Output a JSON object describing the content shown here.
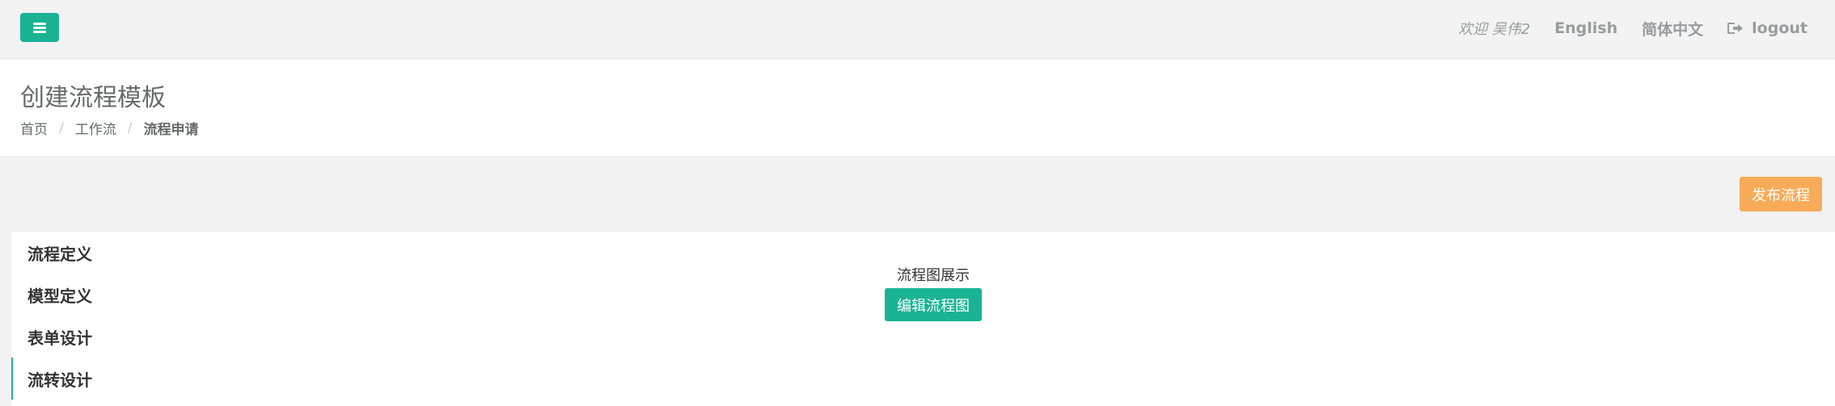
{
  "colors": {
    "accent": "#1ab394",
    "warning": "#f8ac59",
    "topbar_bg": "#f3f3f4"
  },
  "topbar": {
    "menu_icon": "hamburger-icon",
    "welcome": "欢迎 吴伟2",
    "lang_english": "English",
    "lang_chinese": "简体中文",
    "logout_icon": "sign-out-icon",
    "logout": "logout"
  },
  "heading": {
    "title": "创建流程模板",
    "breadcrumb": [
      "首页",
      "工作流",
      "流程申请"
    ]
  },
  "toolbar": {
    "publish": "发布流程"
  },
  "tabs": [
    {
      "label": "流程定义",
      "active": false
    },
    {
      "label": "模型定义",
      "active": false
    },
    {
      "label": "表单设计",
      "active": false
    },
    {
      "label": "流转设计",
      "active": true
    }
  ],
  "content": {
    "diagram_label": "流程图展示",
    "edit_button": "编辑流程图"
  }
}
